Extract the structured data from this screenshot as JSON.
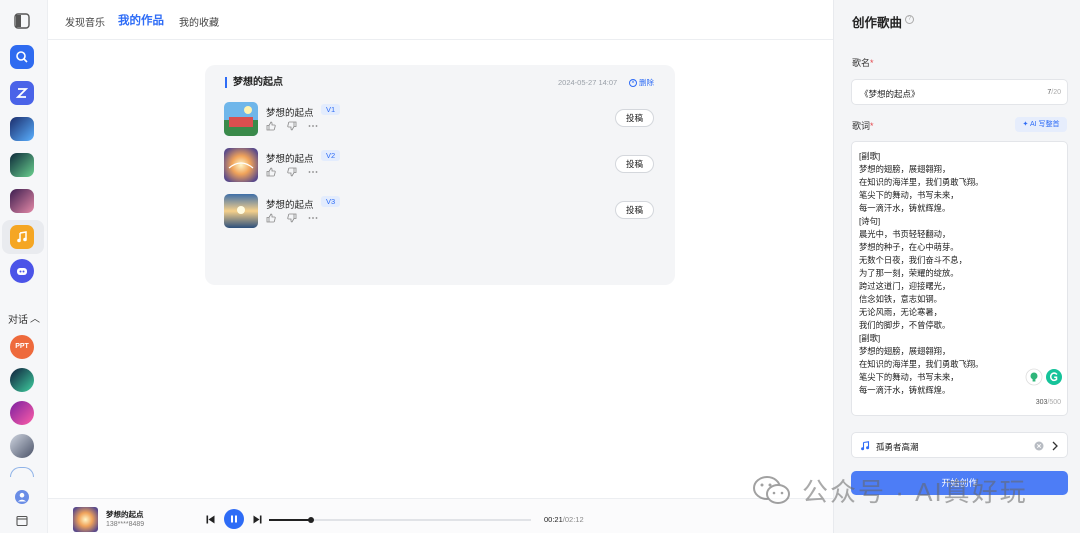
{
  "nav": {
    "tabs": [
      "发现音乐",
      "我的作品",
      "我的收藏"
    ],
    "active_index": 1
  },
  "sidebar": {
    "conversation_label": "对话",
    "ppt_badge": "PPT",
    "icons": [
      "sidebar-toggle-icon",
      "search-icon",
      "z-logo-icon",
      "app-1-icon",
      "app-2-icon",
      "app-3-icon",
      "music-icon",
      "robot-icon",
      "user-icon",
      "window-icon"
    ]
  },
  "work_card": {
    "title": "梦想的起点",
    "date": "2024-05-27 14:07",
    "delete_label": "删除",
    "submit_label": "投稿",
    "songs": [
      {
        "name": "梦想的起点",
        "version": "V1"
      },
      {
        "name": "梦想的起点",
        "version": "V2"
      },
      {
        "name": "梦想的起点",
        "version": "V3"
      }
    ]
  },
  "panel": {
    "title": "创作歌曲",
    "song_name_label": "歌名",
    "song_name_value": "《梦想的起点》",
    "song_name_count": "7",
    "song_name_max": "/20",
    "lyrics_label": "歌词",
    "ai_button": "AI 写整首",
    "lyrics": [
      "[副歌]",
      "梦想的翅膀，展翅翱翔，",
      "在知识的海洋里，我们勇敢飞翔。",
      "笔尖下的舞动，书写未来，",
      "每一滴汗水，铸就辉煌。",
      "[诗句]",
      "晨光中，书页轻轻翻动，",
      "梦想的种子，在心中萌芽。",
      "无数个日夜，我们奋斗不息，",
      "为了那一刻，荣耀的绽放。",
      "跨过这道门，迎接曙光，",
      "信念如铁，意志如钢。",
      "无论风雨，无论寒暑，",
      "我们的脚步，不曾停歇。",
      "[副歌]",
      "梦想的翅膀，展翅翱翔，",
      "在知识的海洋里，我们勇敢飞翔。",
      "笔尖下的舞动，书写未来，",
      "每一滴汗水，铸就辉煌。"
    ],
    "lyrics_count": "303",
    "lyrics_max": "/500",
    "style_value": "孤勇者高潮",
    "create_button": "开始创作"
  },
  "player": {
    "title": "梦想的起点",
    "user": "138****8489",
    "current_time": "00:21",
    "total_time": "/02:12",
    "progress": 0.16
  },
  "watermark": "公众号 · AI真好玩",
  "colors": {
    "accent": "#2e6cf6",
    "create_button": "#4d7df6",
    "required": "#e5484d"
  }
}
